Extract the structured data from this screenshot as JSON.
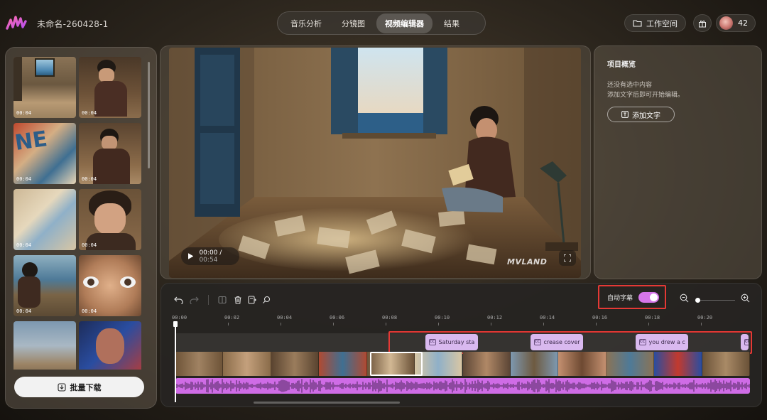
{
  "header": {
    "project_name": "未命名-260428-1",
    "tabs": [
      {
        "label": "音乐分析",
        "active": false
      },
      {
        "label": "分镜图",
        "active": false
      },
      {
        "label": "视频编辑器",
        "active": true
      },
      {
        "label": "结果",
        "active": false
      }
    ],
    "workspace_label": "工作空间",
    "credits": "42",
    "icons": {
      "logo": "waveform-logo-icon",
      "workspace": "folder-icon",
      "gift": "gift-icon",
      "avatar": "user-avatar"
    }
  },
  "left_panel": {
    "thumbnails": [
      {
        "time": "00:04"
      },
      {
        "time": "00:04"
      },
      {
        "time": "00:04"
      },
      {
        "time": "00:04"
      },
      {
        "time": "00:04"
      },
      {
        "time": "00:04"
      },
      {
        "time": "00:04"
      },
      {
        "time": "00:04"
      },
      {
        "time": ""
      },
      {
        "time": ""
      }
    ],
    "download_label": "批量下载"
  },
  "preview": {
    "current_time": "00:00",
    "separator": "/",
    "duration": "00:54",
    "watermark": "MVLAND"
  },
  "right_panel": {
    "title": "项目概览",
    "empty_line1": "还没有选中内容",
    "empty_line2": "添加文字后即可开始编辑。",
    "add_text_label": "添加文字"
  },
  "timeline": {
    "auto_caption_label": "自动字幕",
    "auto_caption_enabled": true,
    "ruler": [
      "00:00",
      "00:02",
      "00:04",
      "00:06",
      "00:08",
      "00:10",
      "00:12",
      "00:14",
      "00:16",
      "00:18",
      "00:20"
    ],
    "captions": [
      {
        "text": "Saturday sta",
        "start": 9.5,
        "end": 11.5
      },
      {
        "text": "crease cover",
        "start": 13.5,
        "end": 15.5
      },
      {
        "text": "you drew a c",
        "start": 17.5,
        "end": 19.5
      },
      {
        "text": "",
        "start": 21.5,
        "end": 21.8
      }
    ],
    "clip_count": 12,
    "selected_clip": 4,
    "zoom_level": 0.05
  },
  "colors": {
    "accent": "#d576e8",
    "highlight": "#e53935",
    "caption_chip": "#d9b9ef",
    "audio": "#cf6ce6"
  }
}
